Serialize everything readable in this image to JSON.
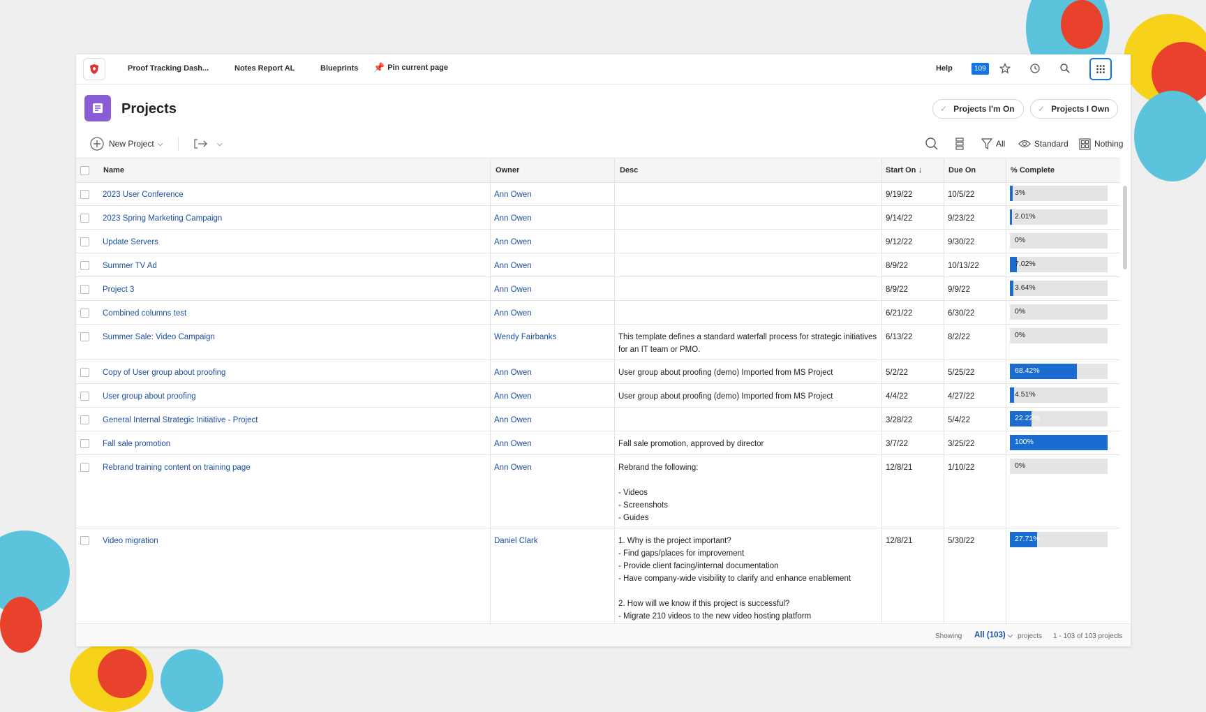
{
  "nav": {
    "links": [
      "Proof Tracking Dash...",
      "Notes Report AL",
      "Blueprints"
    ],
    "pin_label": "Pin current page",
    "help_label": "Help",
    "notification_count": "109"
  },
  "header": {
    "title": "Projects",
    "filters": [
      "Projects I'm On",
      "Projects I Own"
    ]
  },
  "toolbar": {
    "new_project": "New Project",
    "filter_label": "All",
    "view_label": "Standard",
    "grouping_label": "Nothing"
  },
  "table": {
    "columns": [
      "Name",
      "Owner",
      "Desc",
      "Start On",
      "Due On",
      "% Complete"
    ],
    "sort_indicator": "↓",
    "rows": [
      {
        "name": "2023 User Conference",
        "owner": "Ann Owen",
        "desc": "",
        "start": "9/19/22",
        "due": "10/5/22",
        "pct_label": "3%",
        "pct": 3
      },
      {
        "name": "2023 Spring Marketing Campaign",
        "owner": "Ann Owen",
        "desc": "",
        "start": "9/14/22",
        "due": "9/23/22",
        "pct_label": "2.01%",
        "pct": 2.01
      },
      {
        "name": "Update Servers",
        "owner": "Ann Owen",
        "desc": "",
        "start": "9/12/22",
        "due": "9/30/22",
        "pct_label": "0%",
        "pct": 0
      },
      {
        "name": "Summer TV Ad",
        "owner": "Ann Owen",
        "desc": "",
        "start": "8/9/22",
        "due": "10/13/22",
        "pct_label": "7.02%",
        "pct": 7.02
      },
      {
        "name": "Project 3",
        "owner": "Ann Owen",
        "desc": "",
        "start": "8/9/22",
        "due": "9/9/22",
        "pct_label": "3.64%",
        "pct": 3.64
      },
      {
        "name": "Combined columns test",
        "owner": "Ann Owen",
        "desc": "",
        "start": "6/21/22",
        "due": "6/30/22",
        "pct_label": "0%",
        "pct": 0
      },
      {
        "name": "Summer Sale: Video Campaign",
        "owner": "Wendy Fairbanks",
        "desc": "This template defines a standard waterfall process for strategic initiatives for an IT team or PMO.",
        "start": "6/13/22",
        "due": "8/2/22",
        "pct_label": "0%",
        "pct": 0
      },
      {
        "name": "Copy of User group about proofing",
        "owner": "Ann Owen",
        "desc": "User group about proofing (demo) Imported from MS Project",
        "start": "5/2/22",
        "due": "5/25/22",
        "pct_label": "68.42%",
        "pct": 68.42
      },
      {
        "name": "User group about proofing",
        "owner": "Ann Owen",
        "desc": "User group about proofing (demo) Imported from MS Project",
        "start": "4/4/22",
        "due": "4/27/22",
        "pct_label": "4.51%",
        "pct": 4.51
      },
      {
        "name": "General Internal Strategic Initiative - Project",
        "owner": "Ann Owen",
        "desc": "",
        "start": "3/28/22",
        "due": "5/4/22",
        "pct_label": "22.22%",
        "pct": 22.22
      },
      {
        "name": "Fall sale promotion",
        "owner": "Ann Owen",
        "desc": "Fall sale promotion, approved by director",
        "start": "3/7/22",
        "due": "3/25/22",
        "pct_label": "100%",
        "pct": 100
      },
      {
        "name": "Rebrand training content on training page",
        "owner": "Ann Owen",
        "desc": "Rebrand the following:\n\n- Videos\n- Screenshots\n- Guides",
        "start": "12/8/21",
        "due": "1/10/22",
        "pct_label": "0%",
        "pct": 0
      },
      {
        "name": "Video migration",
        "owner": "Daniel Clark",
        "desc": "1. Why is the project important?\n- Find gaps/places for improvement\n- Provide client facing/internal documentation\n- Have company-wide visibility to clarify and enhance enablement\n\n2. How will we know if this project is successful?\n- Migrate 210 videos to the new video hosting platform\n- Internal awareness and enablement",
        "start": "12/8/21",
        "due": "5/30/22",
        "pct_label": "27.71%",
        "pct": 27.71
      }
    ]
  },
  "footer": {
    "showing": "Showing",
    "all_label": "All (103)",
    "projects": "projects",
    "range": "1 - 103 of 103 projects"
  },
  "colors": {
    "accent": "#1473e6",
    "progress": "#1a6cd1",
    "link": "#1d4fa0",
    "page_icon": "#8a5cd6"
  }
}
